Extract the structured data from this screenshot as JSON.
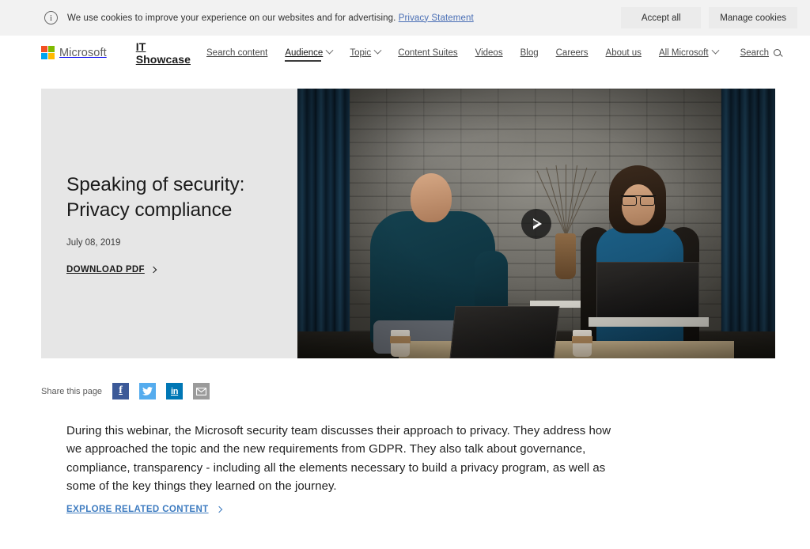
{
  "cookie_banner": {
    "icon": "info-icon",
    "message": "We use cookies to improve your experience on our websites and for advertising.",
    "privacy_link": "Privacy Statement",
    "accept_label": "Accept all",
    "manage_label": "Manage cookies"
  },
  "nav": {
    "logo_word": "Microsoft",
    "brand": "IT Showcase",
    "items": [
      {
        "label": "Search content",
        "has_chevron": false,
        "active": false
      },
      {
        "label": "Audience",
        "has_chevron": true,
        "active": true
      },
      {
        "label": "Topic",
        "has_chevron": true,
        "active": false
      },
      {
        "label": "Content Suites",
        "has_chevron": false,
        "active": false
      },
      {
        "label": "Videos",
        "has_chevron": false,
        "active": false
      },
      {
        "label": "Blog",
        "has_chevron": false,
        "active": false
      },
      {
        "label": "Careers",
        "has_chevron": false,
        "active": false
      },
      {
        "label": "About us",
        "has_chevron": false,
        "active": false
      }
    ],
    "all_microsoft": "All Microsoft",
    "search_label": "Search"
  },
  "hero": {
    "title": "Speaking of security: Privacy compliance",
    "date": "July 08, 2019",
    "cta_label": "DOWNLOAD PDF",
    "video_alt": "Two presenters seated in front of a gray brick wall with blue curtains, laptops and coffee cups on a table",
    "play_button": "play-icon"
  },
  "share": {
    "label": "Share this page",
    "icons": [
      {
        "name": "facebook-icon",
        "glyph": "f",
        "color": "#3b5998"
      },
      {
        "name": "twitter-icon",
        "glyph": "",
        "color": "#55acee"
      },
      {
        "name": "linkedin-icon",
        "glyph": "in",
        "color": "#0077b5"
      },
      {
        "name": "email-icon",
        "glyph": "",
        "color": "#9b9b9b"
      }
    ]
  },
  "article": {
    "paragraph": "During this webinar, the Microsoft security team discusses their approach to privacy. They address how we approached the topic and the new requirements from GDPR. They also talk about governance, compliance, transparency - including all the elements necessary to build a privacy program, as well as some of the key things they learned on the journey.",
    "explore_label": "EXPLORE RELATED CONTENT"
  },
  "colors": {
    "page_bg": "#ffffff",
    "banner_bg": "#f2f2f2",
    "hero_panel_bg": "#e6e6e6",
    "link_blue": "#3d7bc0",
    "cookie_link_blue": "#4a6fb5"
  }
}
